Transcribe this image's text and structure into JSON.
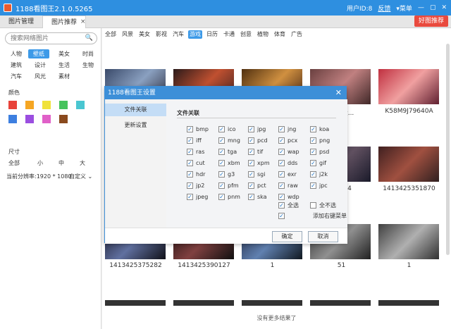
{
  "app": {
    "title": "1188看图王2.1.0.5265",
    "user_id": "用户ID:8",
    "feedback": "反馈",
    "menu": "菜单"
  },
  "tabs": [
    {
      "label": "图片管理"
    },
    {
      "label": "图片推荐"
    }
  ],
  "tab_close": "×",
  "promo": "好图推荐",
  "search": {
    "placeholder": "搜索网络图片"
  },
  "categories": [
    "人物",
    "壁纸",
    "美女",
    "时尚",
    "建筑",
    "设计",
    "生活",
    "生物",
    "汽车",
    "风光",
    "素材"
  ],
  "selected_category": "壁纸",
  "color_label": "颜色",
  "colors": [
    "#e8433a",
    "#f5a623",
    "#f0e23a",
    "#46c35d",
    "#4ac6d1",
    "#3d7fe0",
    "#9b4ee0",
    "#e060c8",
    "#8a4a1e"
  ],
  "size_label": "尺寸",
  "sizes": [
    "全部",
    "小",
    "中",
    "大"
  ],
  "resolution": "当前分辨率:1920 * 1080",
  "custom": "自定义",
  "content_tabs": [
    "全部",
    "风景",
    "美女",
    "影视",
    "汽车",
    "游戏",
    "日历",
    "卡通",
    "创意",
    "植物",
    "体育",
    "广告"
  ],
  "selected_content_tab": "游戏",
  "captions_row1": [
    "",
    "",
    "",
    "萝莉金...",
    "K58M9J79640A"
  ],
  "captions_row2": [
    "",
    "",
    "",
    "33564",
    "1413425351870"
  ],
  "captions_row3": [
    "1413425375282",
    "1413425390127",
    "1",
    "51",
    "1"
  ],
  "bottom_message": "没有更多结果了",
  "dialog": {
    "title": "1188看图王设置",
    "nav": [
      "文件关联",
      "更新设置"
    ],
    "section": "文件关联",
    "formats": [
      "bmp",
      "ico",
      "jpg",
      "jng",
      "koa",
      "iff",
      "mng",
      "pcd",
      "pcx",
      "png",
      "ras",
      "tga",
      "tif",
      "wap",
      "psd",
      "cut",
      "xbm",
      "xpm",
      "dds",
      "gif",
      "hdr",
      "g3",
      "sgi",
      "exr",
      "j2k",
      "jp2",
      "pfm",
      "pct",
      "raw",
      "jpc",
      "jpeg",
      "pnm",
      "ska",
      "wdp"
    ],
    "select_all": "全选",
    "select_none": "全不选",
    "context_menu": "添加右键菜单",
    "ok": "确定",
    "cancel": "取消"
  }
}
